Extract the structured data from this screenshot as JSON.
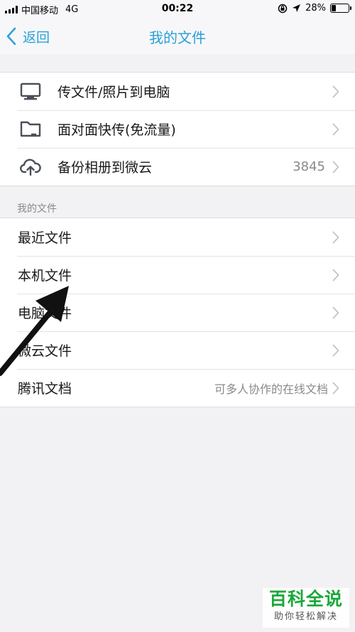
{
  "status_bar": {
    "carrier": "中国移动",
    "network": "4G",
    "time": "00:22",
    "battery": "28%",
    "battery_level": 0.28
  },
  "nav": {
    "back_label": "返回",
    "title": "我的文件"
  },
  "transfer_group": {
    "items": [
      {
        "label": "传文件/照片到电脑",
        "icon": "monitor-icon"
      },
      {
        "label": "面对面快传(免流量)",
        "icon": "folder-icon"
      },
      {
        "label": "备份相册到微云",
        "icon": "cloud-upload-icon",
        "value": "3845"
      }
    ]
  },
  "files_section": {
    "header": "我的文件",
    "items": [
      {
        "label": "最近文件"
      },
      {
        "label": "本机文件"
      },
      {
        "label": "电脑文件"
      },
      {
        "label": "微云文件"
      },
      {
        "label": "腾讯文档",
        "value": "可多人协作的在线文档"
      }
    ]
  },
  "watermark": {
    "main": "百科全说",
    "sub": "助你轻松解决"
  },
  "colors": {
    "accent": "#2aa0d6",
    "background": "#f2f2f4",
    "watermark_green": "#1aa83a"
  }
}
